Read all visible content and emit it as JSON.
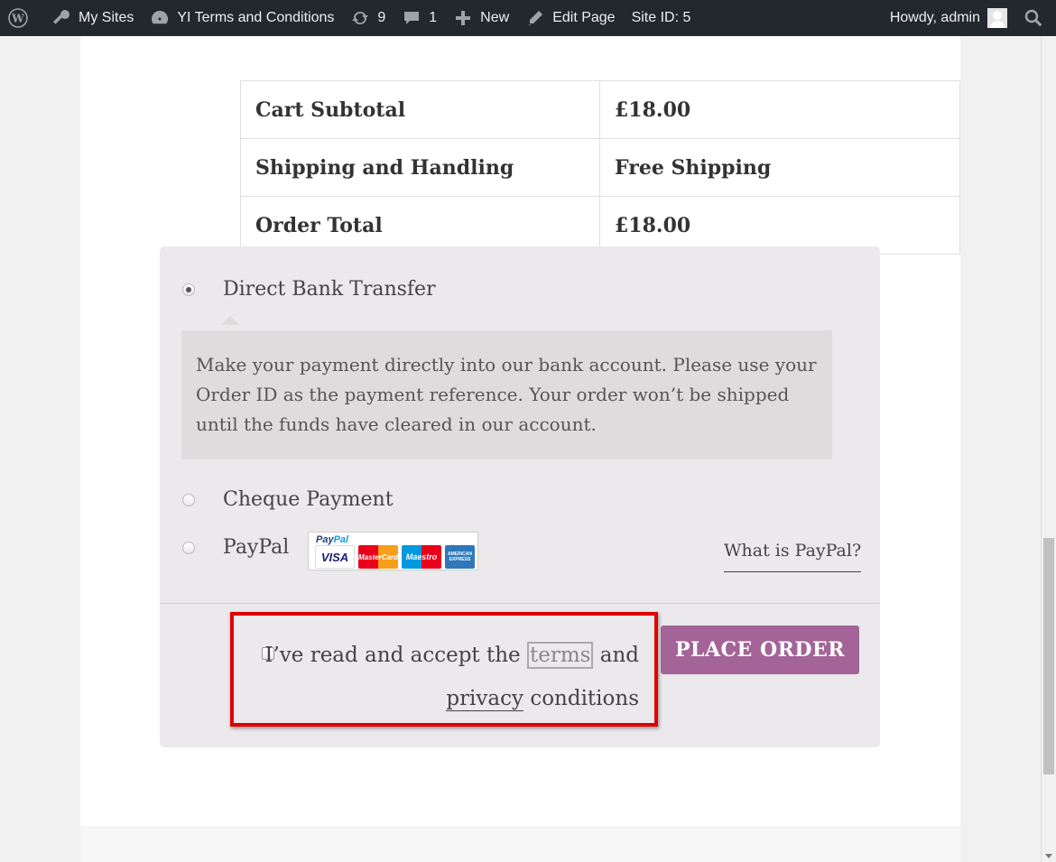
{
  "adminbar": {
    "my_sites": "My Sites",
    "site_name": "YI Terms and Conditions",
    "updates_count": "9",
    "comments_count": "1",
    "new_label": "New",
    "edit_page": "Edit Page",
    "site_id": "Site ID: 5",
    "howdy": "Howdy, admin"
  },
  "totals": {
    "rows": [
      {
        "label": "Cart Subtotal",
        "value": "£18.00"
      },
      {
        "label": "Shipping and Handling",
        "value": "Free Shipping"
      },
      {
        "label": "Order Total",
        "value": "£18.00"
      }
    ]
  },
  "payment": {
    "methods": [
      {
        "label": "Direct Bank Transfer",
        "selected": true
      },
      {
        "label": "Cheque Payment",
        "selected": false
      },
      {
        "label": "PayPal",
        "selected": false
      }
    ],
    "bacs_description": "Make your payment directly into our bank account. Please use your Order ID as the payment reference. Your order won’t be shipped until the funds have cleared in our account.",
    "paypal_mark": {
      "pay": "Pay",
      "pal": "Pal"
    },
    "cards": {
      "visa": "VISA",
      "mastercard": "MasterCard",
      "maestro": "Maestro",
      "amex": "AMERICAN EXPRESS"
    },
    "what_is_paypal": "What is PayPal?"
  },
  "terms": {
    "prefix": "I’ve read and accept the",
    "terms_link": "terms",
    "and": "and",
    "privacy_link": "privacy",
    "suffix": "conditions"
  },
  "place_order": "PLACE ORDER",
  "colors": {
    "accent": "#a46497",
    "highlight": "#e00000",
    "adminbar": "#23282d"
  }
}
